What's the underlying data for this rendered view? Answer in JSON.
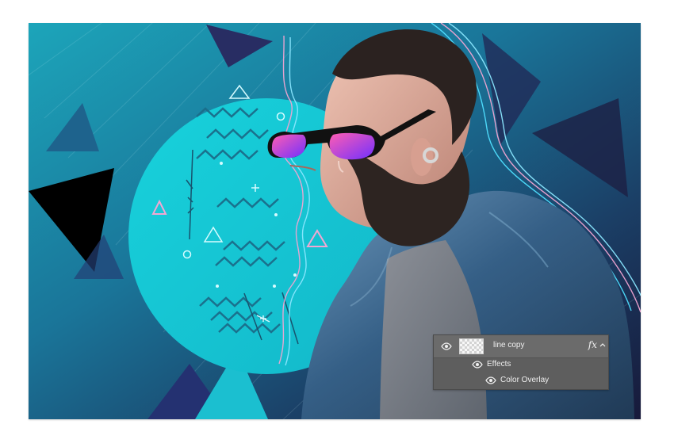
{
  "canvas": {
    "description_icon": "image-canvas"
  },
  "layers_panel": {
    "layer_name": "line copy",
    "fx_label": "fx",
    "effects_label": "Effects",
    "effect_item_label": "Color Overlay",
    "layer_visibility_icon": "eye-icon",
    "effects_visibility_icon": "eye-icon",
    "overlay_visibility_icon": "eye-icon",
    "collapse_icon": "chevron-up-icon",
    "thumbnail_icon": "transparent-layer-thumbnail"
  },
  "colors": {
    "panel_bg": "#5e5e5e",
    "panel_row_active": "#6b6b6b",
    "panel_text": "#ededed",
    "accent_cyan": "#16c4d2",
    "accent_pink": "#d86fb1",
    "dark_navy": "#171a3b"
  }
}
